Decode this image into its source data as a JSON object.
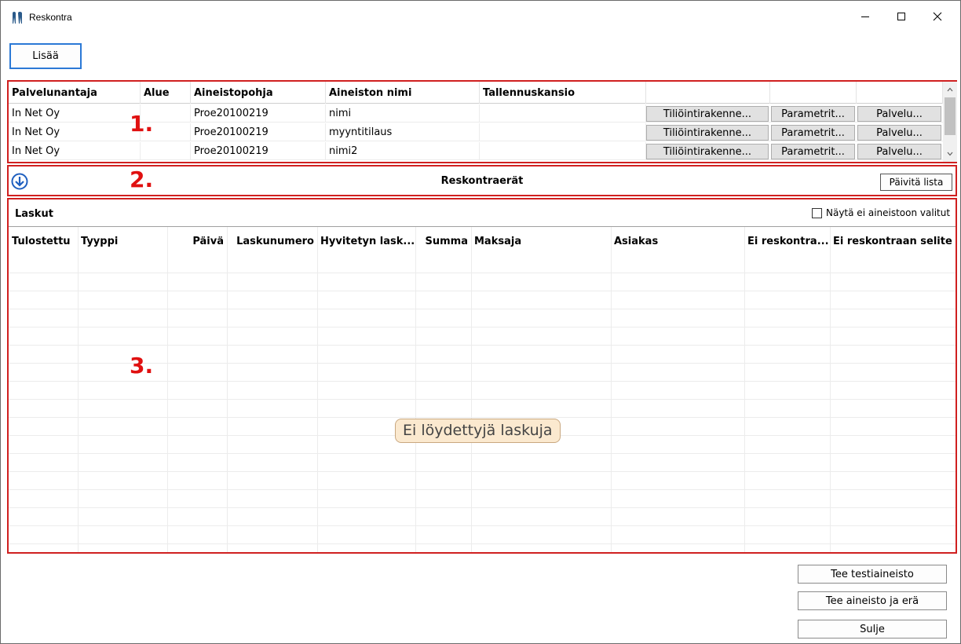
{
  "window": {
    "title": "Reskontra",
    "minimize_glyph": "–",
    "maximize_glyph": "☐",
    "close_glyph": "✕"
  },
  "toolbar": {
    "add_label": "Lisää"
  },
  "markers": {
    "one": "1.",
    "two": "2.",
    "three": "3."
  },
  "services": {
    "columns": [
      "Palvelunantaja",
      "Alue",
      "Aineistopohja",
      "Aineiston nimi",
      "Tallennuskansio"
    ],
    "rows": [
      {
        "provider": "In Net Oy",
        "area": "",
        "template": "Proe20100219",
        "name": "nimi",
        "folder": ""
      },
      {
        "provider": "In Net Oy",
        "area": "",
        "template": "Proe20100219",
        "name": "myyntitilaus",
        "folder": ""
      },
      {
        "provider": "In Net Oy",
        "area": "",
        "template": "Proe20100219",
        "name": "nimi2",
        "folder": ""
      }
    ],
    "button_labels": {
      "accounts": "Tiliöintirakenne...",
      "params": "Parametrit...",
      "service": "Palvelu..."
    },
    "scroll_up_glyph": "^",
    "scroll_down_glyph": "⌄"
  },
  "batches": {
    "title": "Reskontraerät",
    "refresh_label": "Päivitä lista"
  },
  "invoices": {
    "title": "Laskut",
    "show_unselected_label": "Näytä ei aineistoon valitut",
    "show_unselected_checked": false,
    "columns": [
      "Tulostettu",
      "Tyyppi",
      "Päivä",
      "Laskunumero",
      "Hyvitetyn lask...",
      "Summa",
      "Maksaja",
      "Asiakas",
      "Ei reskontra...",
      "Ei reskontraan selite"
    ],
    "empty_message": "Ei löydettyjä laskuja"
  },
  "actions": {
    "test_label": "Tee testiaineisto",
    "create_label": "Tee aineisto ja erä",
    "close_label": "Sulje"
  },
  "colors": {
    "highlight": "#d02020",
    "accent": "#2b79d6",
    "empty_bg": "#fbe9cf"
  }
}
